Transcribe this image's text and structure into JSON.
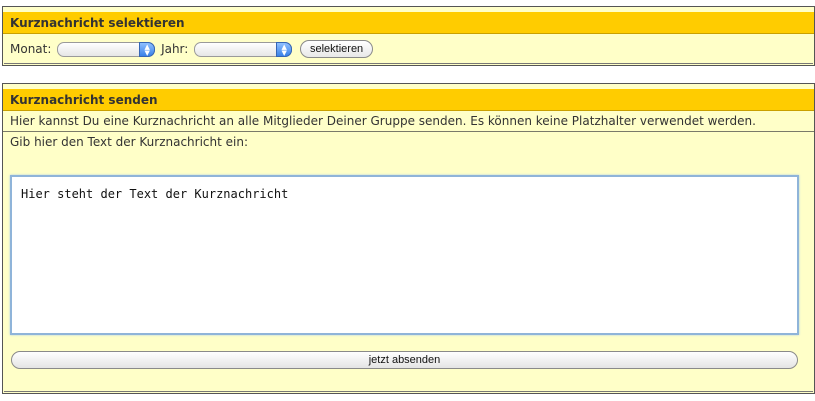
{
  "select_panel": {
    "title": "Kurznachricht selektieren",
    "month_label": "Monat:",
    "month_value": "",
    "year_label": "Jahr:",
    "year_value": "",
    "select_button": "selektieren"
  },
  "send_panel": {
    "title": "Kurznachricht senden",
    "info": "Hier kannst Du eine Kurznachricht an alle Mitglieder Deiner Gruppe senden. Es können keine Platzhalter verwendet werden.",
    "prompt": "Gib hier den Text der Kurznachricht ein:",
    "message_text": "Hier steht der Text der Kurznachricht",
    "send_button": "jetzt absenden"
  },
  "colors": {
    "header_bg": "#ffcc00",
    "panel_bg": "#ffffc8",
    "focus_ring": "#8fb4d9"
  }
}
